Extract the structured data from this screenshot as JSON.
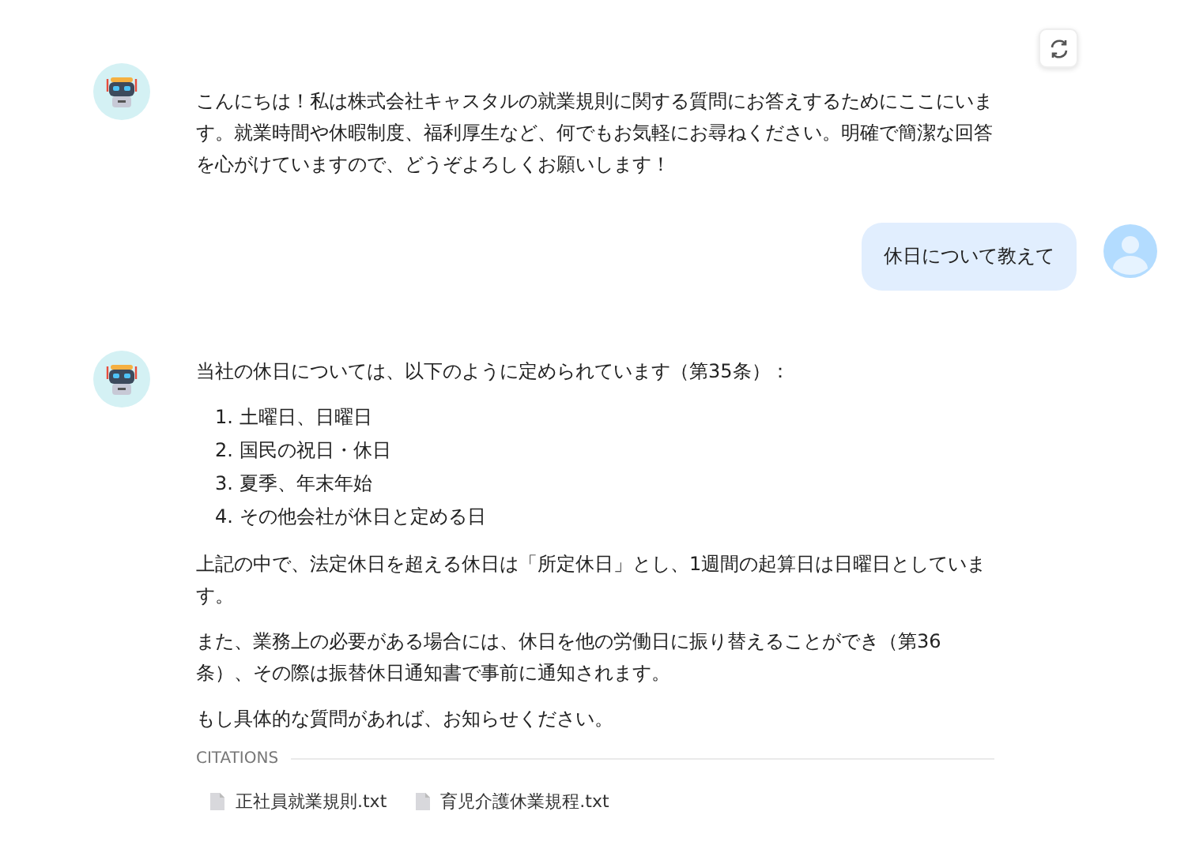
{
  "messages": [
    {
      "kind": "bot",
      "blocks": [
        {
          "kind": "paragraph",
          "text": "こんにちは！私は株式会社キャスタルの就業規則に関する質問にお答えするためにここにいます。就業時間や休暇制度、福利厚生など、何でもお気軽にお尋ねください。明確で簡潔な回答を心がけていますので、どうぞよろしくお願いします！"
        }
      ]
    },
    {
      "kind": "user",
      "text": "休日について教えて"
    },
    {
      "kind": "bot",
      "blocks": [
        {
          "kind": "paragraph",
          "text": "当社の休日については、以下のように定められています（第35条）："
        },
        {
          "kind": "list",
          "items": [
            "1. 土曜日、日曜日",
            "2. 国民の祝日・休日",
            "3. 夏季、年末年始",
            "4. その他会社が休日と定める日"
          ]
        },
        {
          "kind": "paragraph",
          "text": "上記の中で、法定休日を超える休日は「所定休日」とし、1週間の起算日は日曜日としています。"
        },
        {
          "kind": "paragraph",
          "text": "また、業務上の必要がある場合には、休日を他の労働日に振り替えることができ（第36条）、その際は振替休日通知書で事前に通知されます。"
        },
        {
          "kind": "paragraph",
          "text": "もし具体的な質問があれば、お知らせください。"
        }
      ],
      "citations": {
        "title": "CITATIONS",
        "files": [
          "正社員就業規則.txt",
          "育児介護休業規程.txt"
        ]
      }
    }
  ]
}
